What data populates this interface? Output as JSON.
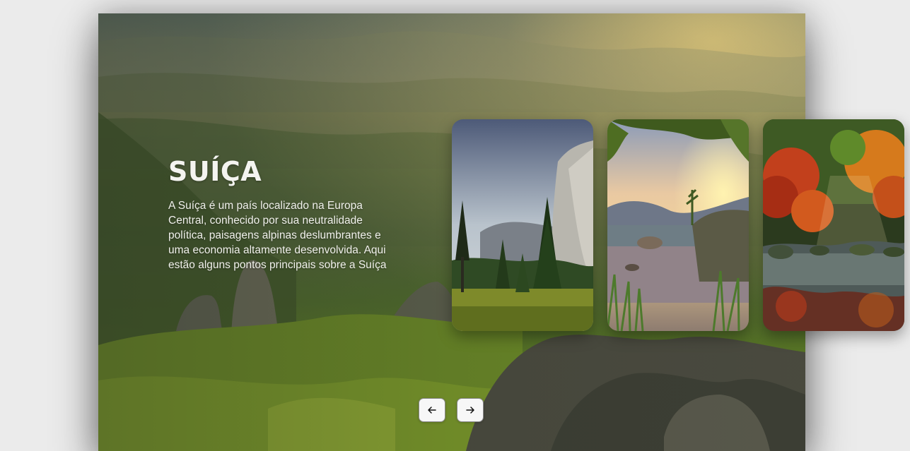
{
  "hero": {
    "title": "SUÍÇA",
    "description": "A Suíça é um país localizado na Europa Central, conhecido por sua neutralidade política, paisagens alpinas deslumbrantes e uma economia altamente desenvolvida. Aqui estão alguns pontos principais sobre a Suíça"
  },
  "cards": [
    {
      "icon": "mountain-forest-image"
    },
    {
      "icon": "sunset-lake-image"
    },
    {
      "icon": "autumn-pond-image"
    }
  ],
  "nav": {
    "prev_icon": "arrow-left-icon",
    "next_icon": "arrow-right-icon"
  },
  "colors": {
    "page_background": "#ebebeb",
    "button_background": "#f7f7f7",
    "title_text": "#f4f4f0"
  }
}
